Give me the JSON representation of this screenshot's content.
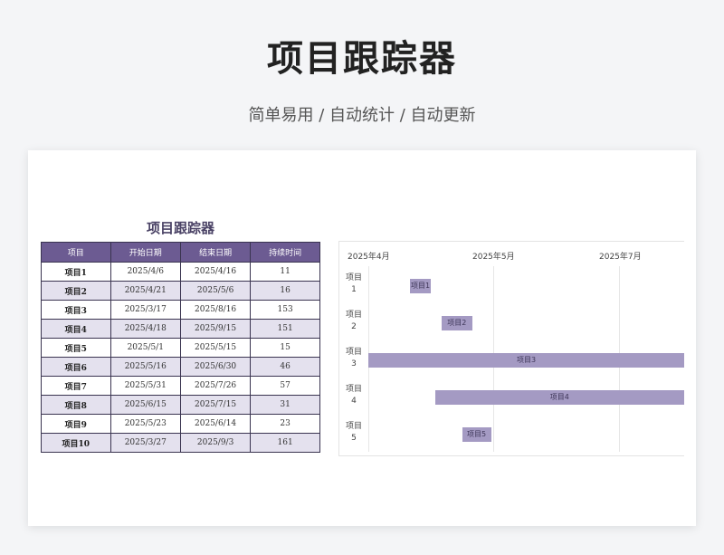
{
  "hero": {
    "title": "项目跟踪器",
    "subtitle": "简单易用  /  自动统计  /  自动更新"
  },
  "sheet": {
    "table_title": "项目跟踪器",
    "columns": [
      "项目",
      "开始日期",
      "结束日期",
      "持续时间"
    ],
    "rows": [
      [
        "项目1",
        "2025/4/6",
        "2025/4/16",
        "11"
      ],
      [
        "项目2",
        "2025/4/21",
        "2025/5/6",
        "16"
      ],
      [
        "项目3",
        "2025/3/17",
        "2025/8/16",
        "153"
      ],
      [
        "项目4",
        "2025/4/18",
        "2025/9/15",
        "151"
      ],
      [
        "项目5",
        "2025/5/1",
        "2025/5/15",
        "15"
      ],
      [
        "项目6",
        "2025/5/16",
        "2025/6/30",
        "46"
      ],
      [
        "项目7",
        "2025/5/31",
        "2025/7/26",
        "57"
      ],
      [
        "项目8",
        "2025/6/15",
        "2025/7/15",
        "31"
      ],
      [
        "项目9",
        "2025/5/23",
        "2025/6/14",
        "23"
      ],
      [
        "项目10",
        "2025/3/27",
        "2025/9/3",
        "161"
      ]
    ]
  },
  "gantt": {
    "axis_labels": [
      "2025年4月",
      "2025年5月",
      "2025年7月"
    ],
    "categories": [
      "项目\n1",
      "项目\n2",
      "项目\n3",
      "项目\n4",
      "项目\n5"
    ],
    "bars": [
      {
        "label": "项目1",
        "start": "2025/4/6",
        "end": "2025/4/16"
      },
      {
        "label": "项目2",
        "start": "2025/4/21",
        "end": "2025/5/6"
      },
      {
        "label": "项目3",
        "start": "2025/3/17",
        "end": "2025/8/16"
      },
      {
        "label": "项目4",
        "start": "2025/4/18",
        "end": "2025/9/15"
      },
      {
        "label": "项目5",
        "start": "2025/5/1",
        "end": "2025/5/15"
      }
    ],
    "bar_color": "#a49ac3",
    "header_color": "#6c5b92"
  }
}
